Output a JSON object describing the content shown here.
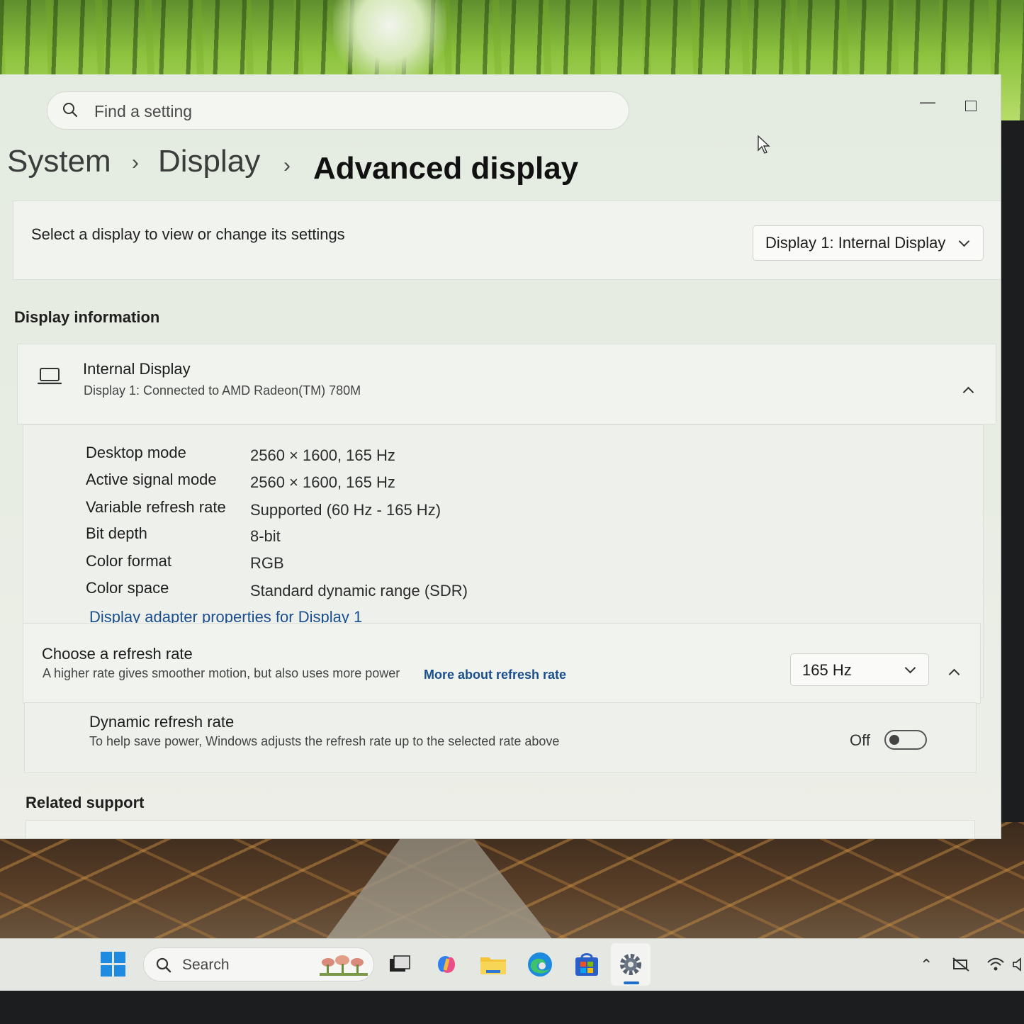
{
  "search": {
    "placeholder": "Find a setting"
  },
  "breadcrumb": {
    "level1": "System",
    "level2": "Display",
    "current": "Advanced display"
  },
  "select_display": {
    "label": "Select a display to view or change its settings",
    "selected": "Display 1: Internal Display"
  },
  "display_information": {
    "heading": "Display information",
    "title": "Internal Display",
    "subtitle": "Display 1: Connected to AMD Radeon(TM) 780M",
    "rows": [
      {
        "label": "Desktop mode",
        "value": "2560 × 1600, 165 Hz"
      },
      {
        "label": "Active signal mode",
        "value": "2560 × 1600, 165 Hz"
      },
      {
        "label": "Variable refresh rate",
        "value": "Supported (60 Hz - 165 Hz)"
      },
      {
        "label": "Bit depth",
        "value": "8-bit"
      },
      {
        "label": "Color format",
        "value": "RGB"
      },
      {
        "label": "Color space",
        "value": "Standard dynamic range (SDR)"
      }
    ],
    "adapter_link": "Display adapter properties for Display 1"
  },
  "refresh_rate": {
    "title": "Choose a refresh rate",
    "description": "A higher rate gives smoother motion, but also uses more power",
    "link": "More about refresh rate",
    "selected": "165 Hz"
  },
  "dynamic_refresh": {
    "title": "Dynamic refresh rate",
    "description": "To help save power, Windows adjusts the refresh rate up to the selected rate above",
    "state_label": "Off",
    "enabled": false
  },
  "related": {
    "heading": "Related support"
  },
  "taskbar": {
    "search_label": "Search",
    "icons": [
      "windows-start-icon",
      "task-view-icon",
      "copilot-icon",
      "file-explorer-icon",
      "edge-icon",
      "store-icon",
      "settings-icon"
    ],
    "tray_icons": [
      "chevron-up-icon",
      "network-off-icon",
      "wifi-icon",
      "volume-icon"
    ]
  },
  "colors": {
    "accent": "#1a4f8c",
    "start": "#1f8be0",
    "toggle_off": "#444444"
  }
}
